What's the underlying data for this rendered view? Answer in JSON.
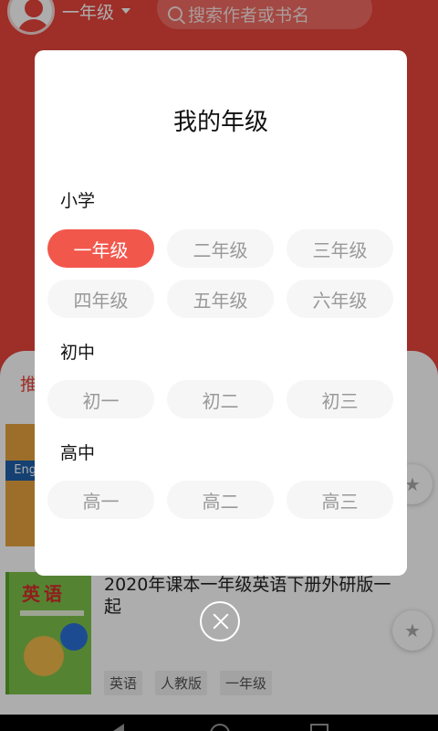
{
  "header": {
    "grade_label": "一年级",
    "search_placeholder": "搜索作者或书名"
  },
  "tab_peek": "推",
  "book_cover_1": {
    "badge_text": "Eng"
  },
  "book_cover_2": {
    "title": "英语"
  },
  "book": {
    "title": "2020年课本一年级英语下册外研版一起",
    "tags": [
      "英语",
      "人教版",
      "一年级"
    ]
  },
  "dialog": {
    "title": "我的年级",
    "sections": [
      {
        "label": "小学",
        "grades": [
          "一年级",
          "二年级",
          "三年级",
          "四年级",
          "五年级",
          "六年级"
        ]
      },
      {
        "label": "初中",
        "grades": [
          "初一",
          "初二",
          "初三"
        ]
      },
      {
        "label": "高中",
        "grades": [
          "高一",
          "高二",
          "高三"
        ]
      }
    ],
    "selected": "一年级"
  },
  "colors": {
    "brand_red": "#e8453c",
    "chip_active": "#f2574c",
    "chip_inactive_bg": "#f6f6f6",
    "chip_inactive_text": "#999999"
  },
  "icons": {
    "close": "close-circle-icon",
    "search": "search-icon",
    "favorite": "star-icon"
  }
}
